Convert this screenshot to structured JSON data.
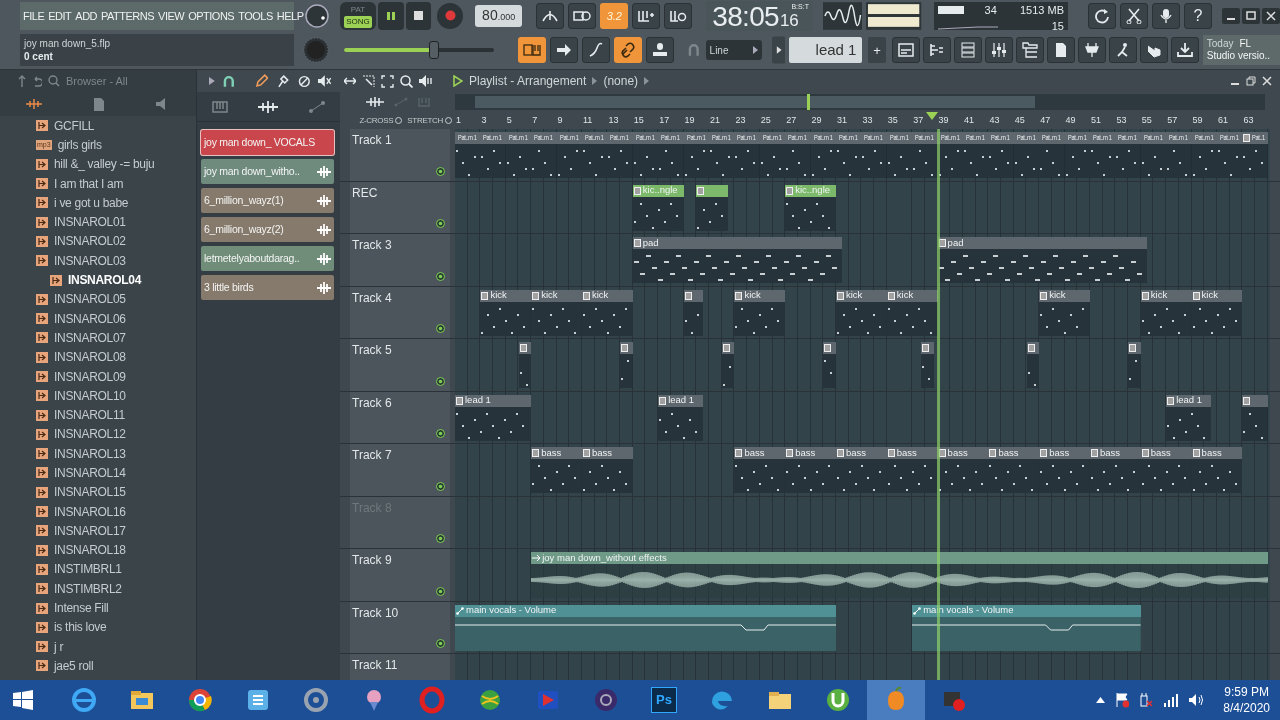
{
  "menu": [
    "FILE",
    "EDIT",
    "ADD",
    "PATTERNS",
    "VIEW",
    "OPTIONS",
    "TOOLS",
    "HELP"
  ],
  "hint": {
    "title": "joy man down_5.flp",
    "detail": "0 cent"
  },
  "transport": {
    "modes": [
      {
        "label": "PAT",
        "selected": false
      },
      {
        "label": "SONG",
        "selected": true
      }
    ],
    "playing": true,
    "tempo_main": "80",
    "tempo_frac": ".000"
  },
  "master_volume": {
    "level": 0.6
  },
  "snap_badge": "3.2",
  "time": {
    "main": "38:05",
    "sub": "16",
    "format": "B:S:T"
  },
  "cpu": {
    "value": "34",
    "memory": "1513 MB",
    "polyphony": "15"
  },
  "help_glyph": "?",
  "snap": {
    "value": "Line"
  },
  "pattern_selector": {
    "value": "lead 1",
    "add": "+"
  },
  "news": {
    "line1_a": "Today",
    "line1_b": "FL",
    "line2": "Studio versio.."
  },
  "browser": {
    "title": "Browser - All",
    "items": [
      {
        "label": "GCFILL",
        "selected": false
      },
      {
        "label": "girls girls",
        "badge": "mp3",
        "selected": false
      },
      {
        "label": "hill &_ valley -= buju",
        "selected": false
      },
      {
        "label": "I am that I am",
        "selected": false
      },
      {
        "label": "i ve got u  babe",
        "selected": false
      },
      {
        "label": "INSNAROL01",
        "selected": false
      },
      {
        "label": "INSNAROL02",
        "selected": false
      },
      {
        "label": "INSNAROL03",
        "selected": false
      },
      {
        "label": "INSNAROL04",
        "selected": true
      },
      {
        "label": "INSNAROL05",
        "selected": false
      },
      {
        "label": "INSNAROL06",
        "selected": false
      },
      {
        "label": "INSNAROL07",
        "selected": false
      },
      {
        "label": "INSNAROL08",
        "selected": false
      },
      {
        "label": "INSNAROL09",
        "selected": false
      },
      {
        "label": "INSNAROL10",
        "selected": false
      },
      {
        "label": "INSNAROL11",
        "selected": false
      },
      {
        "label": "INSNAROL12",
        "selected": false
      },
      {
        "label": "INSNAROL13",
        "selected": false
      },
      {
        "label": "INSNAROL14",
        "selected": false
      },
      {
        "label": "INSNAROL15",
        "selected": false
      },
      {
        "label": "INSNAROL16",
        "selected": false
      },
      {
        "label": "INSNAROL17",
        "selected": false
      },
      {
        "label": "INSNAROL18",
        "selected": false
      },
      {
        "label": "INSTIMBRL1",
        "selected": false
      },
      {
        "label": "INSTIMBRL2",
        "selected": false
      },
      {
        "label": "Intense Fill",
        "selected": false
      },
      {
        "label": "is this love",
        "selected": false
      },
      {
        "label": "j r",
        "selected": false
      },
      {
        "label": "jae5 roll",
        "selected": false
      }
    ]
  },
  "picker": {
    "items": [
      {
        "label": "joy man down_ VOCALS",
        "color": "#c9474c",
        "selected": true
      },
      {
        "label": "joy man down_witho..",
        "color": "#6e8b7d",
        "selected": false
      },
      {
        "label": "6_million_wayz(1)",
        "color": "#857a6b",
        "selected": false
      },
      {
        "label": "6_million_wayz(2)",
        "color": "#857a6b",
        "selected": false
      },
      {
        "label": "letmetelyaboutdarag..",
        "color": "#6f8d78",
        "selected": false
      },
      {
        "label": "3 little birds",
        "color": "#857a6b",
        "selected": false
      }
    ]
  },
  "playlist": {
    "title": "Playlist - Arrangement",
    "pattern": "(none)",
    "zcross": "Z-CROSS",
    "stretch": "STRETCH",
    "ruler_labels": [
      "1",
      "3",
      "5",
      "7",
      "9",
      "11",
      "13",
      "15",
      "17",
      "19",
      "21",
      "23",
      "25",
      "27",
      "29",
      "31",
      "33",
      "35",
      "37",
      "39",
      "41",
      "43",
      "45",
      "47",
      "49",
      "51",
      "53",
      "55",
      "57",
      "59",
      "61",
      "63"
    ],
    "tracks": [
      {
        "name": "Track 1",
        "dimmed": false,
        "color": "#5e676d",
        "clips": [
          {
            "kind": "pattern",
            "label": "Pat..rn 1"
          },
          {
            "kind": "pattern",
            "label": "Pat..rn 1"
          },
          {
            "kind": "pattern",
            "label": "Pat..rn 1"
          },
          {
            "kind": "pattern",
            "label": "Pat..rn 1"
          },
          {
            "kind": "pattern",
            "label": "Pat..rn 1"
          },
          {
            "kind": "pattern",
            "label": "Pat..rn 1"
          },
          {
            "kind": "pattern",
            "label": "Pat..rn 1"
          },
          {
            "kind": "pattern",
            "label": "Pat..rn 1"
          },
          {
            "kind": "pattern",
            "label": "Pat..rn 1"
          },
          {
            "kind": "pattern",
            "label": "Pat..rn 1"
          },
          {
            "kind": "pattern",
            "label": "Pat..rn 1"
          },
          {
            "kind": "pattern",
            "label": "Pat..rn 1"
          },
          {
            "kind": "pattern",
            "label": "Pat..rn 1"
          },
          {
            "kind": "pattern",
            "label": "Pat..rn 1"
          },
          {
            "kind": "pattern",
            "label": "Pat..rn 1"
          },
          {
            "kind": "pattern",
            "label": "Pat..rn 1"
          },
          {
            "kind": "pattern",
            "label": "Pat..rn 1"
          },
          {
            "kind": "pattern",
            "label": "Pat..rn 1"
          },
          {
            "kind": "pattern",
            "label": "Pat..rn 1"
          },
          {
            "kind": "pattern",
            "label": "Pat..rn 1"
          },
          {
            "kind": "pattern",
            "label": "Pat..rn 1"
          },
          {
            "kind": "pattern",
            "label": "Pat..rn 1"
          },
          {
            "kind": "pattern",
            "label": "Pat..rn 1"
          },
          {
            "kind": "pattern",
            "label": "Pat..rn 1"
          },
          {
            "kind": "pattern",
            "label": "Pat..rn 1"
          },
          {
            "kind": "pattern",
            "label": "Pat..rn 1"
          },
          {
            "kind": "pattern",
            "label": "Pat..rn 1"
          },
          {
            "kind": "pattern",
            "label": "Pat..rn 1"
          },
          {
            "kind": "pattern",
            "label": "Pat..rn 1"
          },
          {
            "kind": "pattern",
            "label": "Pat..rn 1"
          },
          {
            "kind": "pattern",
            "label": "Pat..rn 1"
          },
          {
            "kind": "pattern",
            "label": "Pat..1"
          }
        ]
      },
      {
        "name": "REC",
        "dimmed": false,
        "color": "#7cb96a",
        "clips": [
          {
            "kind": "pattern",
            "label": "kic..ngle"
          },
          {
            "kind": "pattern"
          },
          {
            "kind": "pattern",
            "label": "kic..ngle"
          }
        ]
      },
      {
        "name": "Track 3",
        "dimmed": false,
        "color": "#5e676d",
        "clips": [
          {
            "kind": "pattern",
            "label": "pad"
          },
          {
            "kind": "pattern",
            "label": "pad"
          }
        ]
      },
      {
        "name": "Track 4",
        "dimmed": false,
        "color": "#5e676d",
        "clips": [
          {
            "kind": "pattern",
            "label": "kick"
          },
          {
            "kind": "pattern",
            "label": "kick"
          },
          {
            "kind": "pattern",
            "label": "kick"
          },
          {
            "kind": "pattern"
          },
          {
            "kind": "pattern",
            "label": "kick"
          },
          {
            "kind": "pattern",
            "label": "kick"
          },
          {
            "kind": "pattern",
            "label": "kick"
          },
          {
            "kind": "pattern",
            "label": "kick"
          },
          {
            "kind": "pattern",
            "label": "kick"
          },
          {
            "kind": "pattern",
            "label": "kick"
          }
        ]
      },
      {
        "name": "Track 5",
        "dimmed": false,
        "color": "#5e676d",
        "clips": [
          {
            "kind": "pattern"
          },
          {
            "kind": "pattern"
          },
          {
            "kind": "pattern"
          },
          {
            "kind": "pattern"
          },
          {
            "kind": "pattern"
          },
          {
            "kind": "pattern"
          },
          {
            "kind": "pattern"
          }
        ]
      },
      {
        "name": "Track 6",
        "dimmed": false,
        "color": "#5e676d",
        "clips": [
          {
            "kind": "pattern",
            "label": "lead 1"
          },
          {
            "kind": "pattern",
            "label": "lead 1"
          },
          {
            "kind": "pattern",
            "label": "lead 1"
          },
          {
            "kind": "pattern"
          }
        ]
      },
      {
        "name": "Track 7",
        "dimmed": false,
        "color": "#5e676d",
        "clips": [
          {
            "kind": "pattern",
            "label": "bass"
          },
          {
            "kind": "pattern",
            "label": "bass"
          },
          {
            "kind": "pattern",
            "label": "bass"
          },
          {
            "kind": "pattern",
            "label": "bass"
          },
          {
            "kind": "pattern",
            "label": "bass"
          },
          {
            "kind": "pattern",
            "label": "bass"
          },
          {
            "kind": "pattern",
            "label": "bass"
          },
          {
            "kind": "pattern",
            "label": "bass"
          },
          {
            "kind": "pattern",
            "label": "bass"
          },
          {
            "kind": "pattern",
            "label": "bass"
          },
          {
            "kind": "pattern",
            "label": "bass"
          },
          {
            "kind": "pattern",
            "label": "bass"
          }
        ]
      },
      {
        "name": "Track 8",
        "dimmed": true
      },
      {
        "name": "Track 9",
        "dimmed": false,
        "color": "#6f9a88",
        "clips": [
          {
            "kind": "audio",
            "label": "joy man down_without effects"
          }
        ]
      },
      {
        "name": "Track 10",
        "dimmed": false,
        "color": "#4f9195",
        "clips": [
          {
            "kind": "automation",
            "label": "main vocals - Volume"
          },
          {
            "kind": "automation",
            "label": "main vocals - Volume"
          }
        ]
      },
      {
        "name": "Track 11",
        "dimmed": false
      }
    ]
  },
  "taskbar": {
    "apps": [
      {
        "kind": "ie",
        "selected": false
      },
      {
        "kind": "explorer",
        "selected": false
      },
      {
        "kind": "chrome",
        "selected": false
      },
      {
        "kind": "blue-app",
        "selected": false
      },
      {
        "kind": "ring-app",
        "selected": false
      },
      {
        "kind": "pin-app",
        "selected": false
      },
      {
        "kind": "opera",
        "selected": false
      },
      {
        "kind": "globe-app",
        "selected": false
      },
      {
        "kind": "arrow-app",
        "selected": false
      },
      {
        "kind": "dark-app",
        "selected": false
      },
      {
        "kind": "photoshop",
        "label": "Ps",
        "selected": false
      },
      {
        "kind": "edge",
        "selected": false
      },
      {
        "kind": "folder",
        "selected": false
      },
      {
        "kind": "torrent",
        "selected": false
      },
      {
        "kind": "fruit",
        "selected": true
      },
      {
        "kind": "record-app",
        "selected": false
      }
    ],
    "time": "9:59 PM",
    "date": "8/4/2020"
  }
}
